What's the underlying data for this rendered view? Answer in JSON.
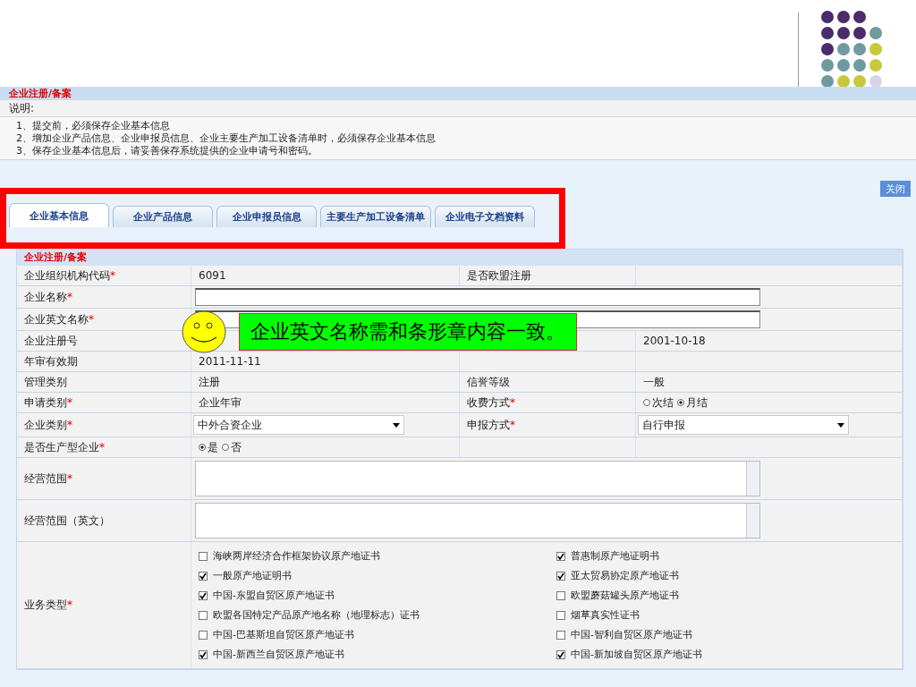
{
  "page": {
    "title": "企业注册/备案",
    "note_label": "说明:",
    "notes": [
      "1、提交前，必须保存企业基本信息",
      "2、增加企业产品信息、企业申报员信息、企业主要生产加工设备清单时，必须保存企业基本信息",
      "3、保存企业基本信息后，请妥善保存系统提供的企业申请号和密码。"
    ],
    "close_button": "关闭"
  },
  "tabs": [
    {
      "label": "企业基本信息",
      "selected": true
    },
    {
      "label": "企业产品信息",
      "selected": false
    },
    {
      "label": "企业申报员信息",
      "selected": false
    },
    {
      "label": "主要生产加工设备清单",
      "selected": false
    },
    {
      "label": "企业电子文档资料",
      "selected": false
    }
  ],
  "form": {
    "section_title": "企业注册/备案",
    "rows": [
      {
        "label": "企业组织机构代码",
        "asterisk": "*",
        "field": {
          "kind": "text",
          "text": "6091"
        },
        "label2": "是否欧盟注册"
      },
      {
        "label": "企业名称",
        "asterisk": "*",
        "field": {
          "kind": "input"
        }
      },
      {
        "label": "企业英文名称",
        "asterisk": "*",
        "field": {
          "kind": "input"
        }
      },
      {
        "label": "企业注册号",
        "field2": {
          "kind": "text",
          "text": "2001-10-18"
        }
      },
      {
        "label": "年审有效期",
        "field": {
          "kind": "text",
          "text": "2011-11-11"
        }
      },
      {
        "label": "管理类别",
        "field": {
          "kind": "text",
          "text": "注册"
        },
        "label2": "信誉等级",
        "field2": {
          "kind": "text",
          "text": "一般"
        }
      },
      {
        "label": "申请类别",
        "asterisk": "*",
        "field": {
          "kind": "text",
          "text": "企业年审"
        },
        "label2": "收费方式",
        "asterisk2": "*",
        "field2": {
          "kind": "radio",
          "options": [
            {
              "label": "次结",
              "selected": false
            },
            {
              "label": "月结",
              "selected": true
            }
          ]
        }
      },
      {
        "label": "企业类别",
        "asterisk": "*",
        "field": {
          "kind": "select",
          "value": "中外合资企业"
        },
        "label2": "申报方式",
        "asterisk2": "*",
        "field2": {
          "kind": "select",
          "value": "自行申报"
        }
      },
      {
        "label": "是否生产型企业",
        "asterisk": "*",
        "field": {
          "kind": "radio",
          "options": [
            {
              "label": "是",
              "selected": true
            },
            {
              "label": "否",
              "selected": false
            }
          ]
        }
      },
      {
        "label": "经营范围",
        "asterisk": "*",
        "field": {
          "kind": "textarea"
        }
      },
      {
        "label": "经营范围（英文）",
        "field": {
          "kind": "textarea"
        }
      },
      {
        "label": "业务类型",
        "asterisk": "*",
        "field": {
          "kind": "checks",
          "items": [
            {
              "label": "海峡两岸经济合作框架协议原产地证书",
              "checked": false
            },
            {
              "label": "普惠制原产地证明书",
              "checked": true
            },
            {
              "label": "一般原产地证明书",
              "checked": true
            },
            {
              "label": "亚太贸易协定原产地证书",
              "checked": true
            },
            {
              "label": "中国-东盟自贸区原产地证书",
              "checked": true
            },
            {
              "label": "欧盟蘑菇罐头原产地证书",
              "checked": false
            },
            {
              "label": "欧盟各国特定产品原产地名称（地理标志）证书",
              "checked": false
            },
            {
              "label": "烟草真实性证书",
              "checked": false
            },
            {
              "label": "中国-巴基斯坦自贸区原产地证书",
              "checked": false
            },
            {
              "label": "中国-智利自贸区原产地证书",
              "checked": false
            },
            {
              "label": "中国-新西兰自贸区原产地证书",
              "checked": true
            },
            {
              "label": "中国-新加坡自贸区原产地证书",
              "checked": true
            }
          ]
        }
      }
    ]
  },
  "callout": {
    "text": "企业英文名称需和条形章内容一致。"
  }
}
